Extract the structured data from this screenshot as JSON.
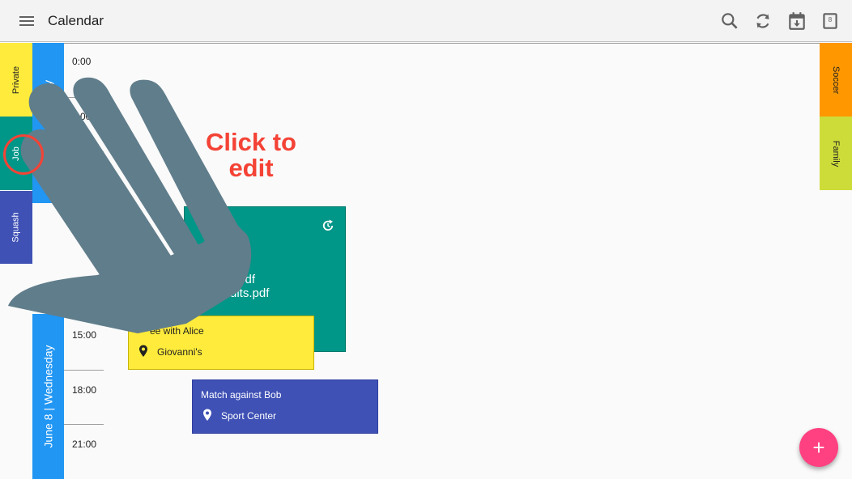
{
  "appbar": {
    "title": "Calendar",
    "icons": [
      "menu-icon",
      "search-icon",
      "sync-icon",
      "calendar-download-icon",
      "calendar-today-icon"
    ],
    "today_day": "8"
  },
  "left_tabs": [
    {
      "label": "Private",
      "color": "#ffeb3b"
    },
    {
      "label": "Job",
      "color": "#009688"
    },
    {
      "label": "Squash",
      "color": "#3f51b5"
    }
  ],
  "right_tabs": [
    {
      "label": "Soccer",
      "color": "#ff9800"
    },
    {
      "label": "Family",
      "color": "#cddc39"
    }
  ],
  "days": [
    {
      "label": "June 7 | Tuesday"
    },
    {
      "label": "June 8 | Wednesday"
    }
  ],
  "times": [
    "0:00",
    "3:00",
    "15:00",
    "18:00",
    "21:00"
  ],
  "events": {
    "teal": {
      "files": [
        ".pdf",
        "ults.pdf"
      ],
      "color": "#009688"
    },
    "coffee": {
      "title": "ee with Alice",
      "location": "Giovanni's",
      "color": "#ffeb3b"
    },
    "match": {
      "title": "Match against Bob",
      "location": "Sport Center",
      "color": "#3f51b5"
    }
  },
  "hint": "Click to edit",
  "fab_label": "+",
  "colors": {
    "accent": "#ff4081",
    "day_strip": "#2196f3",
    "hint": "#f44336"
  }
}
